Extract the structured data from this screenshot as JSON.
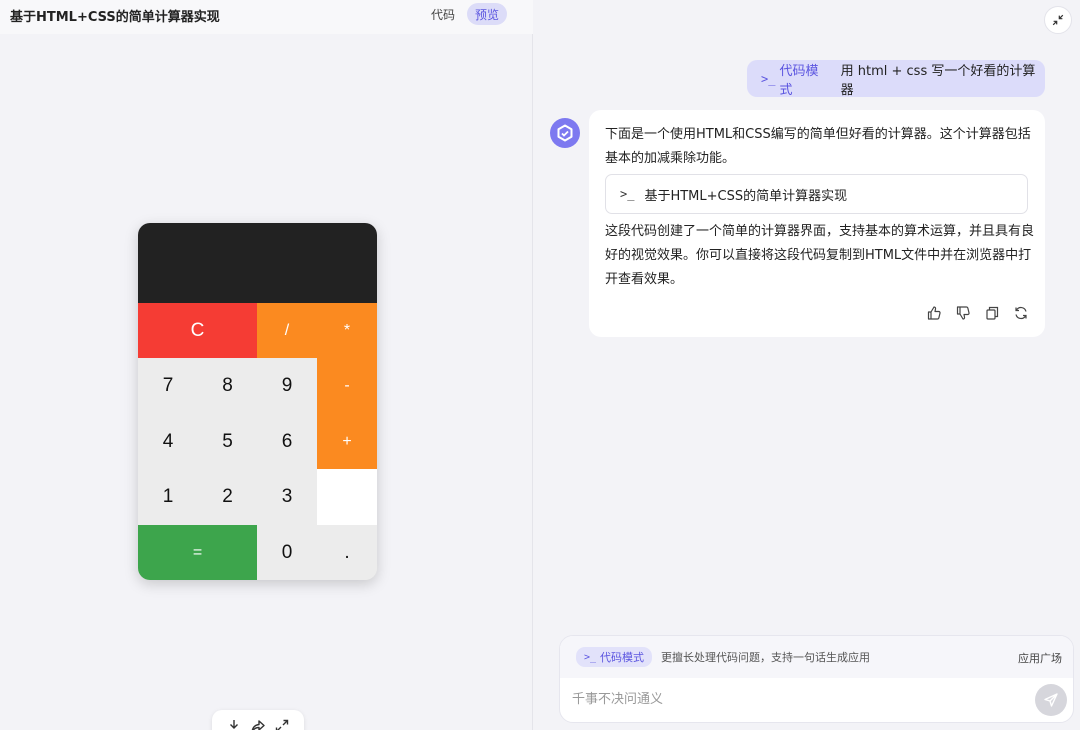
{
  "preview": {
    "title": "基于HTML+CSS的简单计算器实现",
    "tabs": [
      {
        "label": "代码",
        "active": false
      },
      {
        "label": "预览",
        "active": true
      }
    ]
  },
  "calculator": {
    "display_value": "",
    "buttons": {
      "clear": "C",
      "divide": "/",
      "multiply": "*",
      "seven": "7",
      "eight": "8",
      "nine": "9",
      "subtract": "-",
      "four": "4",
      "five": "5",
      "six": "6",
      "add": "+",
      "one": "1",
      "two": "2",
      "three": "3",
      "equals": "=",
      "zero": "0",
      "decimal": "."
    },
    "colors": {
      "display": "#222222",
      "clear": "#f53c34",
      "operator": "#fb8a20",
      "equals": "#3da54c",
      "digit": "#ececec"
    }
  },
  "bottom_tools": {
    "icons": [
      "download-icon",
      "share-icon",
      "expand-icon"
    ]
  },
  "chat": {
    "user_message": {
      "mode_label": "代码模式",
      "text": "用 html + css 写一个好看的计算器"
    },
    "bot_message": {
      "intro": "下面是一个使用HTML和CSS编写的简单但好看的计算器。这个计算器包括基本的加减乘除功能。",
      "code_block_title": "基于HTML+CSS的简单计算器实现",
      "outro": "这段代码创建了一个简单的计算器界面，支持基本的算术运算，并且具有良好的视觉效果。你可以直接将这段代码复制到HTML文件中并在浏览器中打开查看效果。",
      "actions": [
        "thumbs-up-icon",
        "thumbs-down-icon",
        "copy-icon",
        "regenerate-icon"
      ]
    },
    "input": {
      "mode_label": "代码模式",
      "mode_hint": "更擅长处理代码问题，支持一句话生成应用",
      "app_link": "应用广场",
      "placeholder": "千事不决问通义"
    }
  },
  "accent_color": "#5b55e0"
}
